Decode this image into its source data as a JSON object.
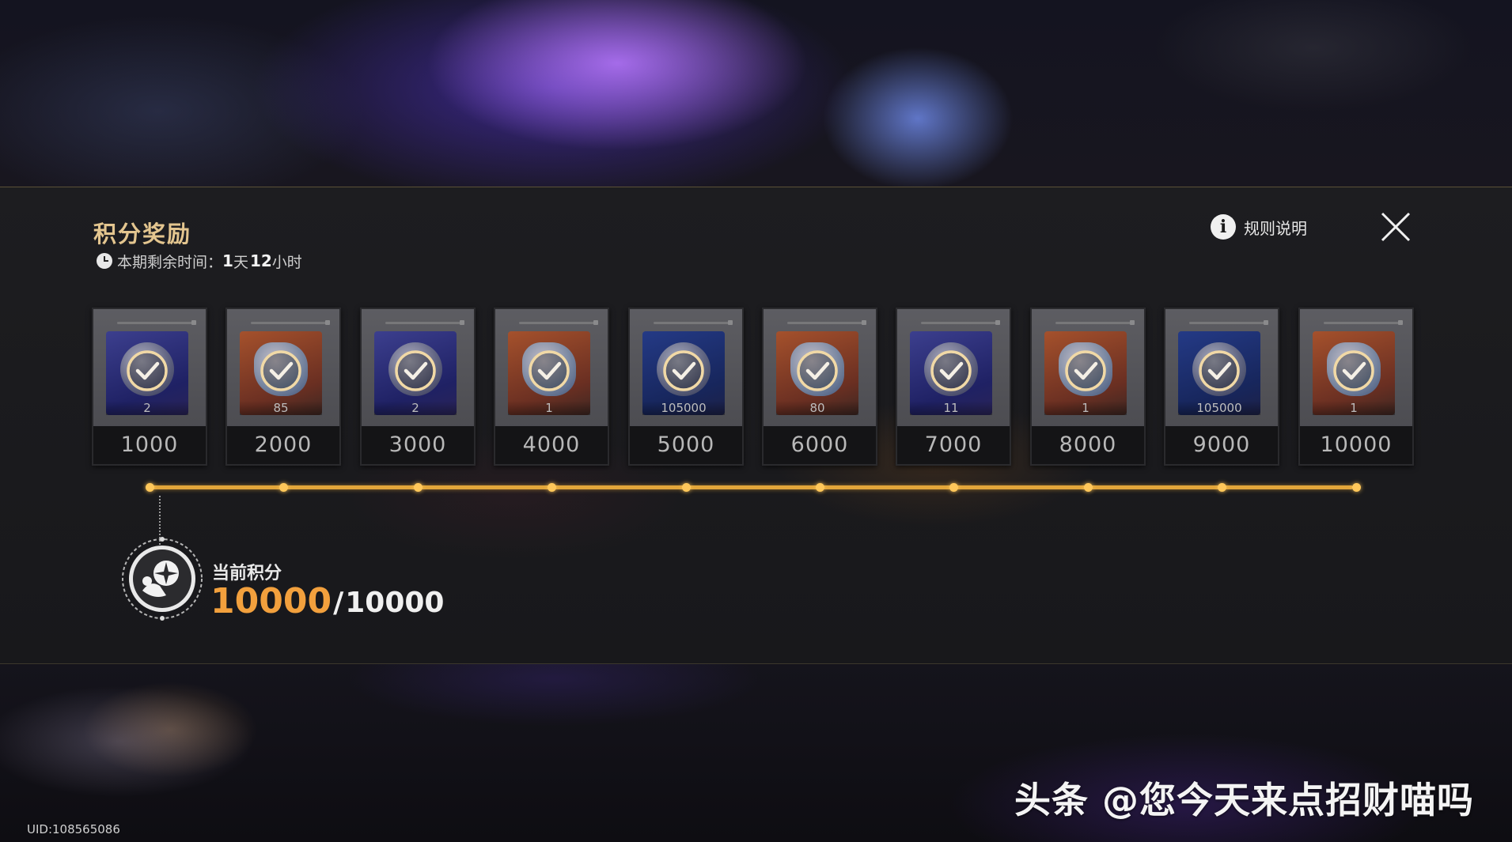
{
  "panel": {
    "title": "积分奖励",
    "timer": {
      "prefix": "本期剩余时间：",
      "days": "1",
      "days_unit": "天",
      "hours": "12",
      "hours_unit": "小时"
    },
    "rules_label": "规则说明"
  },
  "rewards": [
    {
      "score": "1000",
      "qty": "2",
      "theme": "blue",
      "claimed": true
    },
    {
      "score": "2000",
      "qty": "85",
      "theme": "orange",
      "claimed": true
    },
    {
      "score": "3000",
      "qty": "2",
      "theme": "blue",
      "claimed": true
    },
    {
      "score": "4000",
      "qty": "1",
      "theme": "orange",
      "claimed": true
    },
    {
      "score": "5000",
      "qty": "105000",
      "theme": "navy",
      "claimed": true
    },
    {
      "score": "6000",
      "qty": "80",
      "theme": "orange",
      "claimed": true
    },
    {
      "score": "7000",
      "qty": "11",
      "theme": "blue",
      "claimed": true
    },
    {
      "score": "8000",
      "qty": "1",
      "theme": "orange",
      "claimed": true
    },
    {
      "score": "9000",
      "qty": "105000",
      "theme": "navy",
      "claimed": true
    },
    {
      "score": "10000",
      "qty": "1",
      "theme": "orange",
      "claimed": true
    }
  ],
  "current": {
    "label": "当前积分",
    "value": "10000",
    "separator": "/",
    "max": "10000",
    "progress_fraction": 1.0
  },
  "watermark": "头条 @您今天来点招财喵吗",
  "uid": "UID:108565086",
  "colors": {
    "accent_gold": "#e3c58f",
    "progress": "#e2a53a",
    "score_highlight": "#f2a03d"
  },
  "icons": {
    "timer": "clock-icon",
    "rules": "info-icon",
    "close": "close-icon",
    "claimed": "check-circle-icon",
    "badge": "score-badge-icon"
  }
}
